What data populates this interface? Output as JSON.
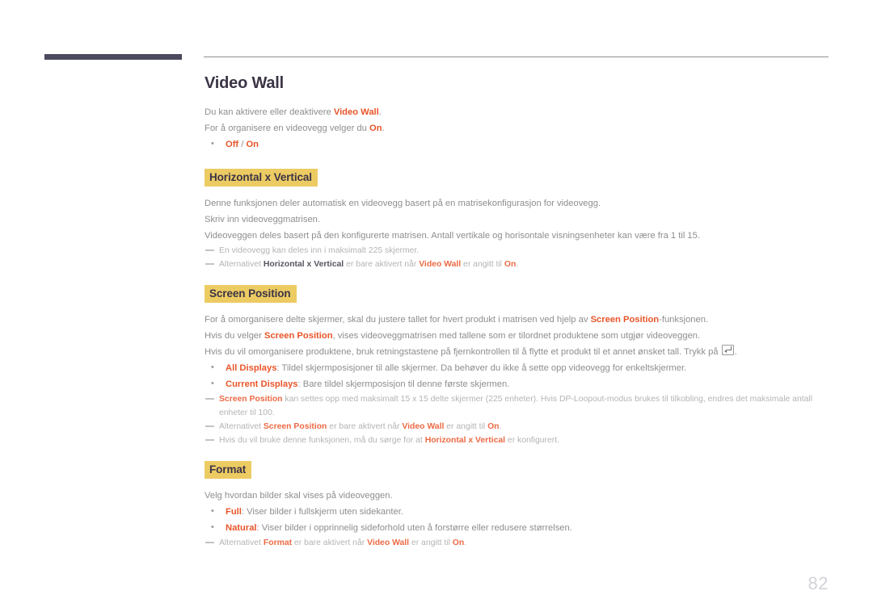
{
  "page": {
    "title": "Video Wall",
    "number": "82",
    "accent_color": "#e8552a",
    "highlight_color": "#eccb63",
    "title_color": "#3c3446",
    "rule_color": "#4b4a5e"
  },
  "intro": {
    "line1_pre": "Du kan aktivere eller deaktivere ",
    "line1_bold": "Video Wall",
    "line1_post": ".",
    "line2_pre": "For å organisere en videovegg velger du ",
    "line2_bold": "On",
    "line2_post": ".",
    "bullet_off": "Off",
    "bullet_sep": " / ",
    "bullet_on": "On"
  },
  "sections": [
    {
      "heading": "Horizontal x Vertical",
      "paragraphs": [
        "Denne funksjonen deler automatisk en videovegg basert på en matrisekonfigurasjon for videovegg.",
        "Skriv inn videoveggmatrisen.",
        "Videoveggen deles basert på den konfigurerte matrisen. Antall vertikale og horisontale visningsenheter kan være fra 1 til 15."
      ],
      "notes": [
        {
          "text": "En videovegg kan deles inn i maksimalt 225 skjermer."
        },
        {
          "pre": "Alternativet ",
          "b1": "Horizontal x Vertical",
          "mid": " er bare aktivert når ",
          "b2": "Video Wall",
          "mid2": " er angitt til ",
          "b3": "On",
          "post": "."
        }
      ]
    },
    {
      "heading": "Screen Position",
      "paragraphs": [],
      "notes": []
    },
    {
      "heading": "Format",
      "paragraphs": [],
      "notes": []
    }
  ],
  "screen_position": {
    "p1_pre": "For å omorganisere delte skjermer, skal du justere tallet for hvert produkt i matrisen ved hjelp av ",
    "p1_bold": "Screen Position",
    "p1_post": "-funksjonen.",
    "p2_pre": "Hvis du velger ",
    "p2_bold": "Screen Position",
    "p2_post": ", vises videoveggmatrisen med tallene som er tilordnet produktene som utgjør videoveggen.",
    "p3": "Hvis du vil omorganisere produktene, bruk retningstastene på fjernkontrollen til å flytte et produkt til et annet ønsket tall. Trykk på ",
    "p3_post": ".",
    "bullet1_bold": "All Displays",
    "bullet1_text": ": Tildel skjermposisjoner til alle skjermer. Da behøver du ikke å sette opp videovegg for enkeltskjermer.",
    "bullet2_bold": "Current Displays",
    "bullet2_text": ": Bare tildel skjermposisjon til denne første skjermen.",
    "note1_b1": "Screen Position",
    "note1_text": " kan settes opp med maksimalt 15 x 15 delte skjermer (225 enheter). Hvis DP-Loopout-modus brukes til tilkobling, endres det maksimale antall enheter til 100.",
    "note2_pre": "Alternativet ",
    "note2_b1": "Screen Position",
    "note2_mid": " er bare aktivert når ",
    "note2_b2": "Video Wall",
    "note2_mid2": " er angitt til ",
    "note2_b3": "On",
    "note2_post": ".",
    "note3_pre": "Hvis du vil bruke denne funksjonen, må du sørge for at ",
    "note3_b1": "Horizontal x Vertical",
    "note3_post": " er konfigurert."
  },
  "format": {
    "p1": "Velg hvordan bilder skal vises på videoveggen.",
    "bullet1_bold": "Full",
    "bullet1_text": ": Viser bilder i fullskjerm uten sidekanter.",
    "bullet2_bold": "Natural",
    "bullet2_text": ": Viser bilder i opprinnelig sideforhold uten å forstørre eller redusere størrelsen.",
    "note1_pre": "Alternativet ",
    "note1_b1": "Format",
    "note1_mid": " er bare aktivert når ",
    "note1_b2": "Video Wall",
    "note1_mid2": " er angitt til ",
    "note1_b3": "On",
    "note1_post": "."
  },
  "icons": {
    "enter_key": "enter-key-icon"
  }
}
